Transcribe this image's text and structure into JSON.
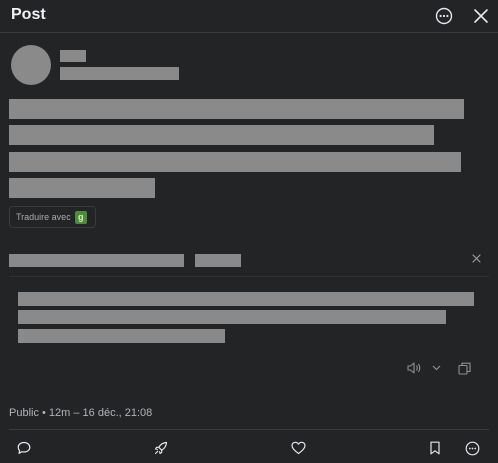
{
  "header": {
    "title": "Post",
    "more_icon": "more-horizontal-circle-icon",
    "close_icon": "close-icon"
  },
  "post": {
    "translate_label": "Traduire avec",
    "translate_logo_text": "g",
    "meta": "Public • 12m – 16 déc., 21:08"
  },
  "actions": [
    "reply-icon",
    "boost-icon",
    "favourite-icon",
    "bookmark-icon",
    "more-icon"
  ],
  "colors": {
    "background": "#232426",
    "redacted": "#8a8a8b",
    "translate_logo": "#4d8b3a"
  }
}
